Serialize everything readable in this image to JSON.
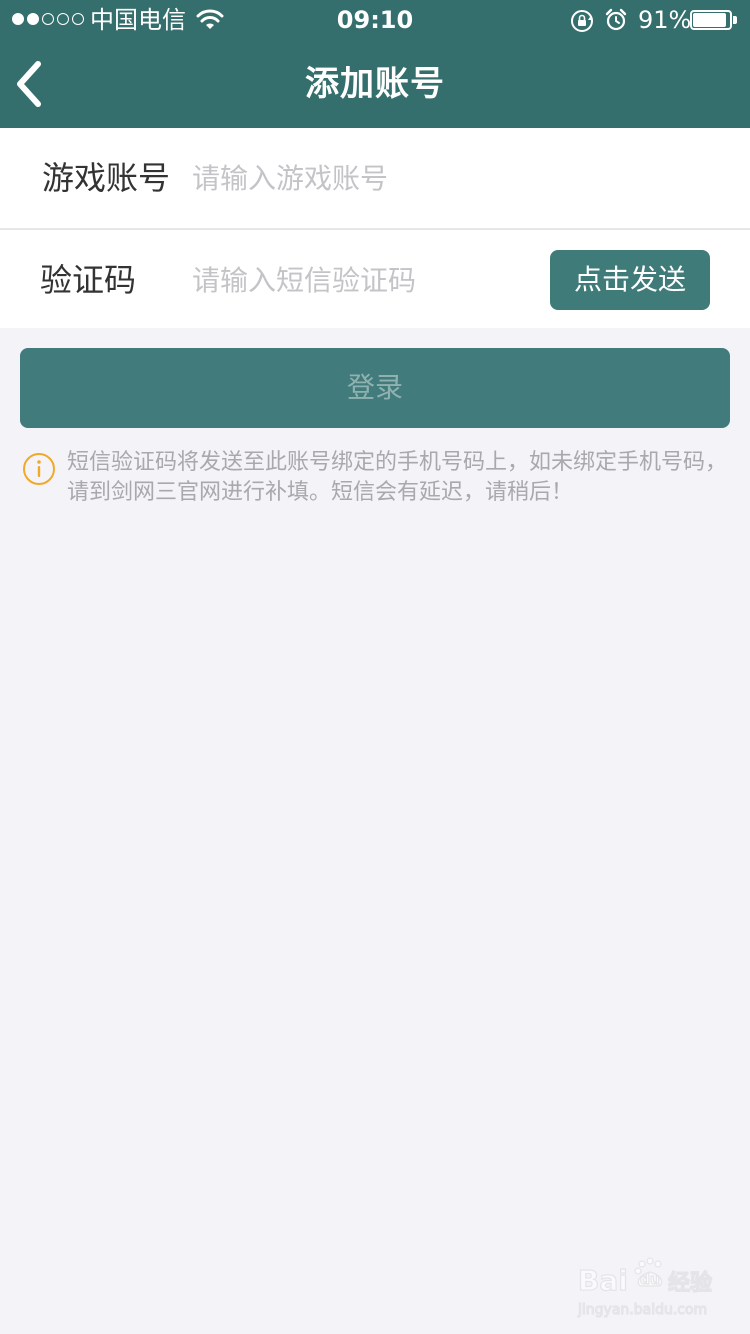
{
  "status_bar": {
    "signal_filled": 2,
    "signal_total": 5,
    "carrier": "中国电信",
    "time": "09:10",
    "battery_percent_text": "91%",
    "battery_level": 0.91
  },
  "nav": {
    "title": "添加账号"
  },
  "form": {
    "account_label": "游戏账号",
    "account_placeholder": "请输入游戏账号",
    "account_value": "",
    "code_label": "验证码",
    "code_placeholder": "请输入短信验证码",
    "code_value": "",
    "send_button": "点击发送",
    "login_button": "登录"
  },
  "notice": {
    "text": "短信验证码将发送至此账号绑定的手机号码上，如未绑定手机号码，请到剑网三官网进行补填。短信会有延迟，请稍后！"
  },
  "colors": {
    "header_bg": "#356f6d",
    "button_bg": "#3f7b79",
    "page_bg": "#f4f3f7",
    "notice_icon": "#f0a92a"
  },
  "icons": {
    "back": "chevron-left-icon",
    "wifi": "wifi-icon",
    "lock": "rotation-lock-icon",
    "alarm": "alarm-icon",
    "battery": "battery-icon",
    "info": "info-icon",
    "watermark": "baidu-jingyan-logo"
  },
  "watermark": {
    "brand": "Baidu经验",
    "url": "jingyan.baidu.com"
  }
}
